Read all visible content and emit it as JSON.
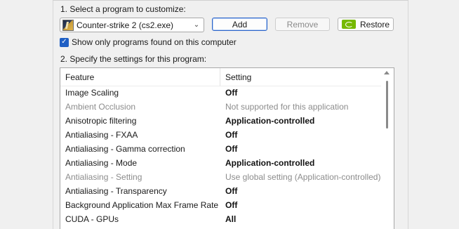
{
  "step1": {
    "label": "1. Select a program to customize:"
  },
  "program_select": {
    "value": "Counter-strike 2 (cs2.exe)",
    "icon": "cs2-app-icon"
  },
  "buttons": {
    "add": "Add",
    "remove": "Remove",
    "restore": "Restore"
  },
  "checkbox": {
    "label": "Show only programs found on this computer",
    "checked": true
  },
  "step2": {
    "label": "2. Specify the settings for this program:"
  },
  "table": {
    "columns": [
      "Feature",
      "Setting"
    ],
    "rows": [
      {
        "feature": "Image Scaling",
        "setting": "Off",
        "enabled": true
      },
      {
        "feature": "Ambient Occlusion",
        "setting": "Not supported for this application",
        "enabled": false
      },
      {
        "feature": "Anisotropic filtering",
        "setting": "Application-controlled",
        "enabled": true
      },
      {
        "feature": "Antialiasing - FXAA",
        "setting": "Off",
        "enabled": true
      },
      {
        "feature": "Antialiasing - Gamma correction",
        "setting": "Off",
        "enabled": true
      },
      {
        "feature": "Antialiasing - Mode",
        "setting": "Application-controlled",
        "enabled": true
      },
      {
        "feature": "Antialiasing - Setting",
        "setting": "Use global setting (Application-controlled)",
        "enabled": false
      },
      {
        "feature": "Antialiasing - Transparency",
        "setting": "Off",
        "enabled": true
      },
      {
        "feature": "Background Application Max Frame Rate",
        "setting": "Off",
        "enabled": true
      },
      {
        "feature": "CUDA - GPUs",
        "setting": "All",
        "enabled": true
      }
    ]
  },
  "colors": {
    "accent": "#1f5fc4",
    "nvidia_green": "#76b900",
    "disabled_text": "#8c8c8c"
  }
}
